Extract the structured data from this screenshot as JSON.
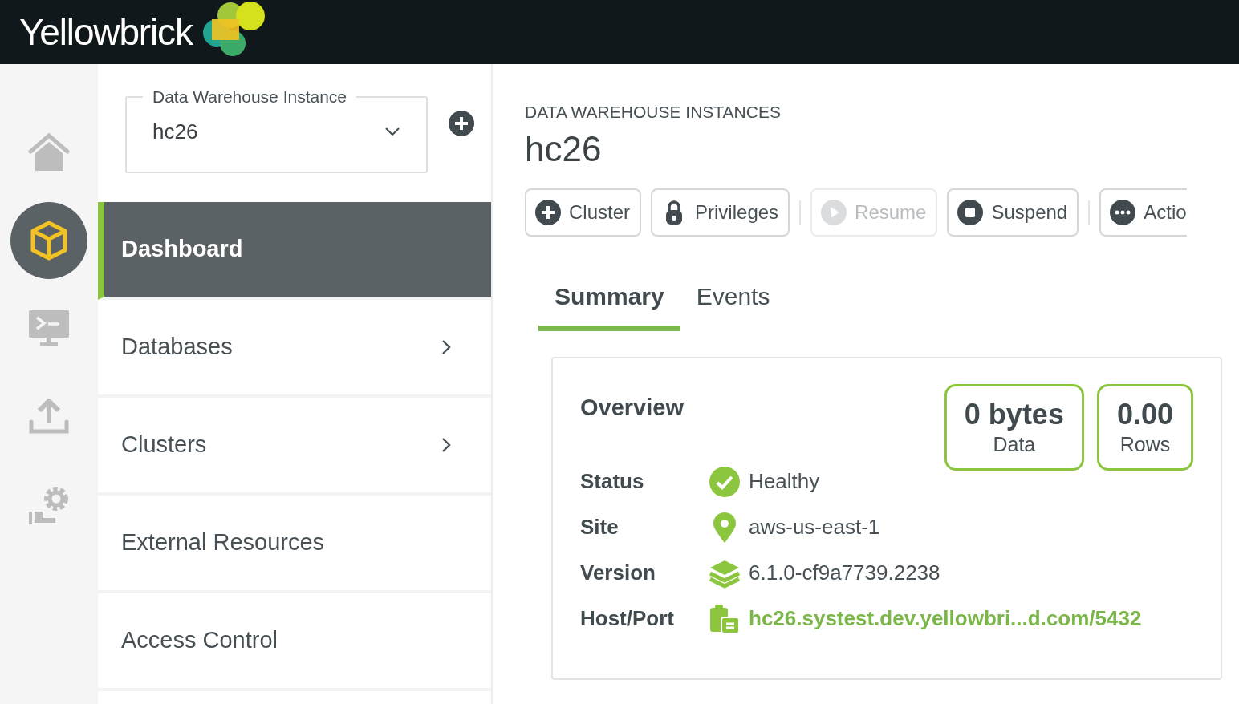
{
  "header": {
    "logo_text": "Yellowbrick"
  },
  "rail": [
    {
      "kind": "home",
      "selected": false
    },
    {
      "kind": "cube",
      "selected": true
    },
    {
      "kind": "terminal",
      "selected": false
    },
    {
      "kind": "upload",
      "selected": false
    },
    {
      "kind": "settings",
      "selected": false
    }
  ],
  "instance_select": {
    "label": "Data Warehouse Instance",
    "value": "hc26"
  },
  "nav": [
    {
      "label": "Dashboard",
      "selected": true,
      "chevron": false
    },
    {
      "label": "Databases",
      "selected": false,
      "chevron": true
    },
    {
      "label": "Clusters",
      "selected": false,
      "chevron": true
    },
    {
      "label": "External Resources",
      "selected": false,
      "chevron": false
    },
    {
      "label": "Access Control",
      "selected": false,
      "chevron": false
    }
  ],
  "breadcrumb": "DATA WAREHOUSE INSTANCES",
  "title": "hc26",
  "actions": [
    {
      "kind": "add",
      "label": "Cluster",
      "disabled": false,
      "separator_after": false
    },
    {
      "kind": "lock",
      "label": "Privileges",
      "disabled": false,
      "separator_after": true
    },
    {
      "kind": "play",
      "label": "Resume",
      "disabled": true,
      "separator_after": false
    },
    {
      "kind": "stop",
      "label": "Suspend",
      "disabled": false,
      "separator_after": true
    },
    {
      "kind": "more",
      "label": "Actio",
      "disabled": false,
      "separator_after": false
    }
  ],
  "tabs": [
    {
      "label": "Summary",
      "selected": true
    },
    {
      "label": "Events",
      "selected": false
    }
  ],
  "overview": {
    "title": "Overview",
    "stats": [
      {
        "value": "0 bytes",
        "label": "Data"
      },
      {
        "value": "0.00",
        "label": "Rows"
      }
    ],
    "rows": [
      {
        "kind": "status",
        "label": "Status",
        "value": "Healthy"
      },
      {
        "kind": "site",
        "label": "Site",
        "value": "aws-us-east-1"
      },
      {
        "kind": "version",
        "label": "Version",
        "value": "6.1.0-cf9a7739.2238"
      },
      {
        "kind": "host",
        "label": "Host/Port",
        "value": "hc26.systest.dev.yellowbri...d.com/5432"
      }
    ]
  }
}
